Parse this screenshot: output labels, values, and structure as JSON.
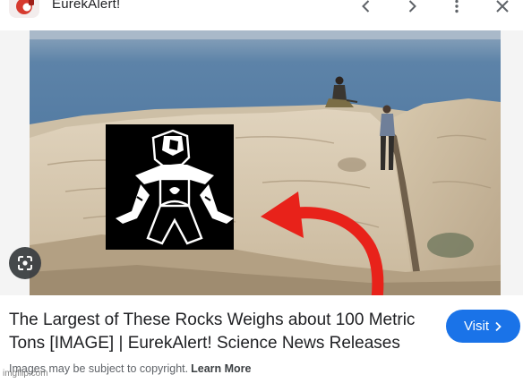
{
  "header": {
    "site_name": "EurekAlert!",
    "icons": [
      "chevron-left-icon",
      "chevron-right-icon",
      "more-vert-icon",
      "close-icon"
    ]
  },
  "image": {
    "lens_icon": "google-lens-icon"
  },
  "result": {
    "title": "The Largest of These Rocks Weighs about 100 Metric Tons [IMAGE] | EurekAlert! Science News Releases",
    "visit_label": "Visit",
    "copyright_text": "Images may be subject to copyright.",
    "learn_more": "Learn More"
  },
  "watermark": "imgflip.com",
  "colors": {
    "accent": "#1a73e8",
    "arrow": "#e8221a",
    "sea": "#4f79a3"
  }
}
